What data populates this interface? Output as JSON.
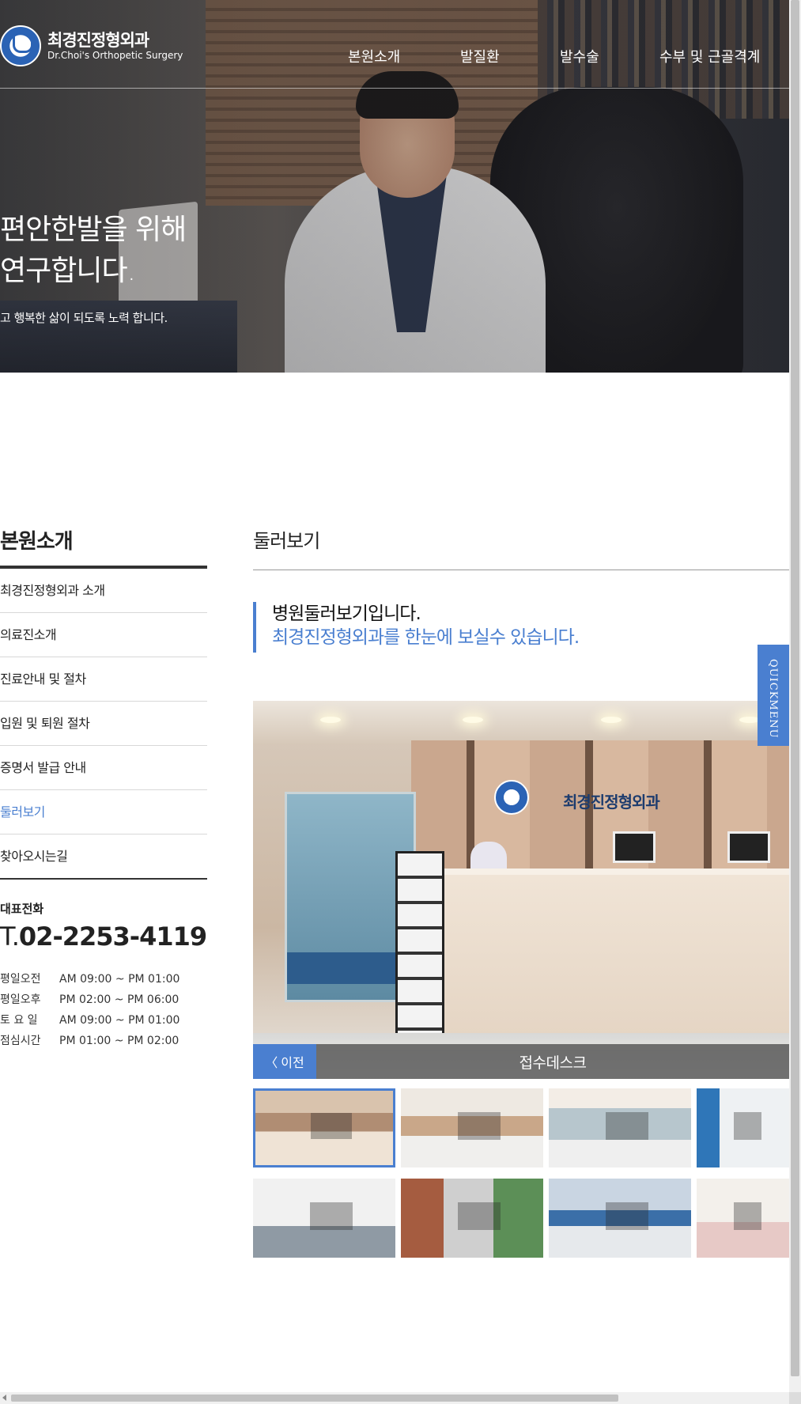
{
  "header": {
    "logo_ko": "최경진정형외과",
    "logo_en": "Dr.Choi's Orthopetic Surgery",
    "nav": [
      "본원소개",
      "발질환",
      "발수술",
      "수부 및 근골격계"
    ]
  },
  "hero": {
    "line1": "편안한발을 위해",
    "line2": "연구합니다.",
    "sub": "고 행복한 삶이 되도록 노력 합니다."
  },
  "sidebar": {
    "title": "본원소개",
    "items": [
      {
        "label": "최경진정형외과 소개",
        "active": false
      },
      {
        "label": "의료진소개",
        "active": false
      },
      {
        "label": "진료안내 및 절차",
        "active": false
      },
      {
        "label": "입원 및 퇴원 절차",
        "active": false
      },
      {
        "label": "증명서 발급 안내",
        "active": false
      },
      {
        "label": "둘러보기",
        "active": true
      },
      {
        "label": "찾아오시는길",
        "active": false
      }
    ],
    "phone_label": "대표전화",
    "phone_prefix": "T.",
    "phone_number": "02-2253-4119",
    "hours": [
      {
        "k": "평일오전",
        "v": "AM 09:00 ~ PM 01:00"
      },
      {
        "k": "평일오후",
        "v": "PM 02:00 ~ PM 06:00"
      },
      {
        "k": "토 요 일",
        "v": "AM 09:00 ~ PM 01:00"
      },
      {
        "k": "점심시간",
        "v": "PM 01:00 ~ PM 02:00"
      }
    ]
  },
  "main": {
    "title": "둘러보기",
    "intro_line1": "병원둘러보기입니다.",
    "intro_line2": "최경진정형외과를 한눈에 보실수 있습니다.",
    "viewer": {
      "prev_label": "이전",
      "caption": "접수데스크",
      "sign_text": "최경진정형외과"
    },
    "thumbnail_count": 8,
    "selected_thumbnail": 1
  },
  "quickmenu": {
    "label": "QUICKMENU"
  },
  "colors": {
    "accent": "#4a7fd0",
    "text": "#222222",
    "rule": "#333333"
  }
}
